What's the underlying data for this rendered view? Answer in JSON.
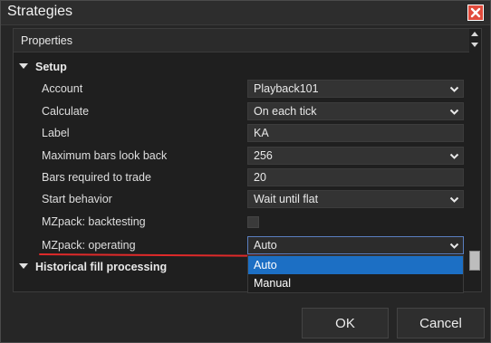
{
  "window": {
    "title": "Strategies",
    "close_icon": "close-icon"
  },
  "panel": {
    "header": "Properties",
    "sections": {
      "setup": "Setup",
      "historical": "Historical fill processing"
    },
    "rows": {
      "account": {
        "label": "Account",
        "value": "Playback101"
      },
      "calculate": {
        "label": "Calculate",
        "value": "On each tick"
      },
      "label": {
        "label": "Label",
        "value": "KA"
      },
      "max_bars": {
        "label": "Maximum bars look back",
        "value": "256"
      },
      "bars_required": {
        "label": "Bars required to trade",
        "value": "20"
      },
      "start_behavior": {
        "label": "Start behavior",
        "value": "Wait until flat"
      },
      "backtesting": {
        "label": "MZpack: backtesting",
        "checked": false
      },
      "operating": {
        "label": "MZpack: operating",
        "value": "Auto"
      }
    }
  },
  "dropdown": {
    "options": [
      "Auto",
      "Manual"
    ],
    "selected": "Auto"
  },
  "buttons": {
    "ok": "OK",
    "cancel": "Cancel"
  },
  "colors": {
    "accent": "#1c6fc4",
    "close": "#e14b3c",
    "annotation": "#e02a2a"
  }
}
